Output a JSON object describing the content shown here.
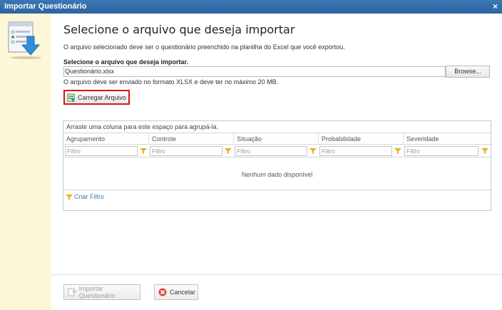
{
  "window": {
    "title": "Importar Questionário",
    "close_glyph": "×"
  },
  "header": {
    "title": "Selecione o arquivo que deseja importar",
    "description": "O arquivo selecionado deve ser o questionário preenchido na planilha do Excel que você exportou."
  },
  "file": {
    "label": "Selecione o arquivo que deseja importar.",
    "value": "Questionário.xlsx",
    "browse_label": "Browse...",
    "hint": "O arquivo deve ser enviado no formato XLSX e deve ter no máximo 20 MB."
  },
  "upload_button": {
    "label": "Carregar Arquivo",
    "icon": "upload-sheet-icon",
    "highlight_color": "#d9141b"
  },
  "grid": {
    "group_hint": "Arraste uma coluna para este espaço para agrupá-la.",
    "columns": [
      "Agrupamento",
      "Controle",
      "Situação",
      "Probabilidade",
      "Severidade"
    ],
    "filter_placeholder": "Filtro",
    "empty_text": "Nenhum dado disponível",
    "create_filter_label": "Criar Filtro"
  },
  "actions": {
    "import_label": "Importar Questionário",
    "cancel_label": "Cancelar"
  },
  "colors": {
    "titlebar": "#2c64a0",
    "side_panel": "#fdf7d9",
    "link": "#3a78b5"
  }
}
